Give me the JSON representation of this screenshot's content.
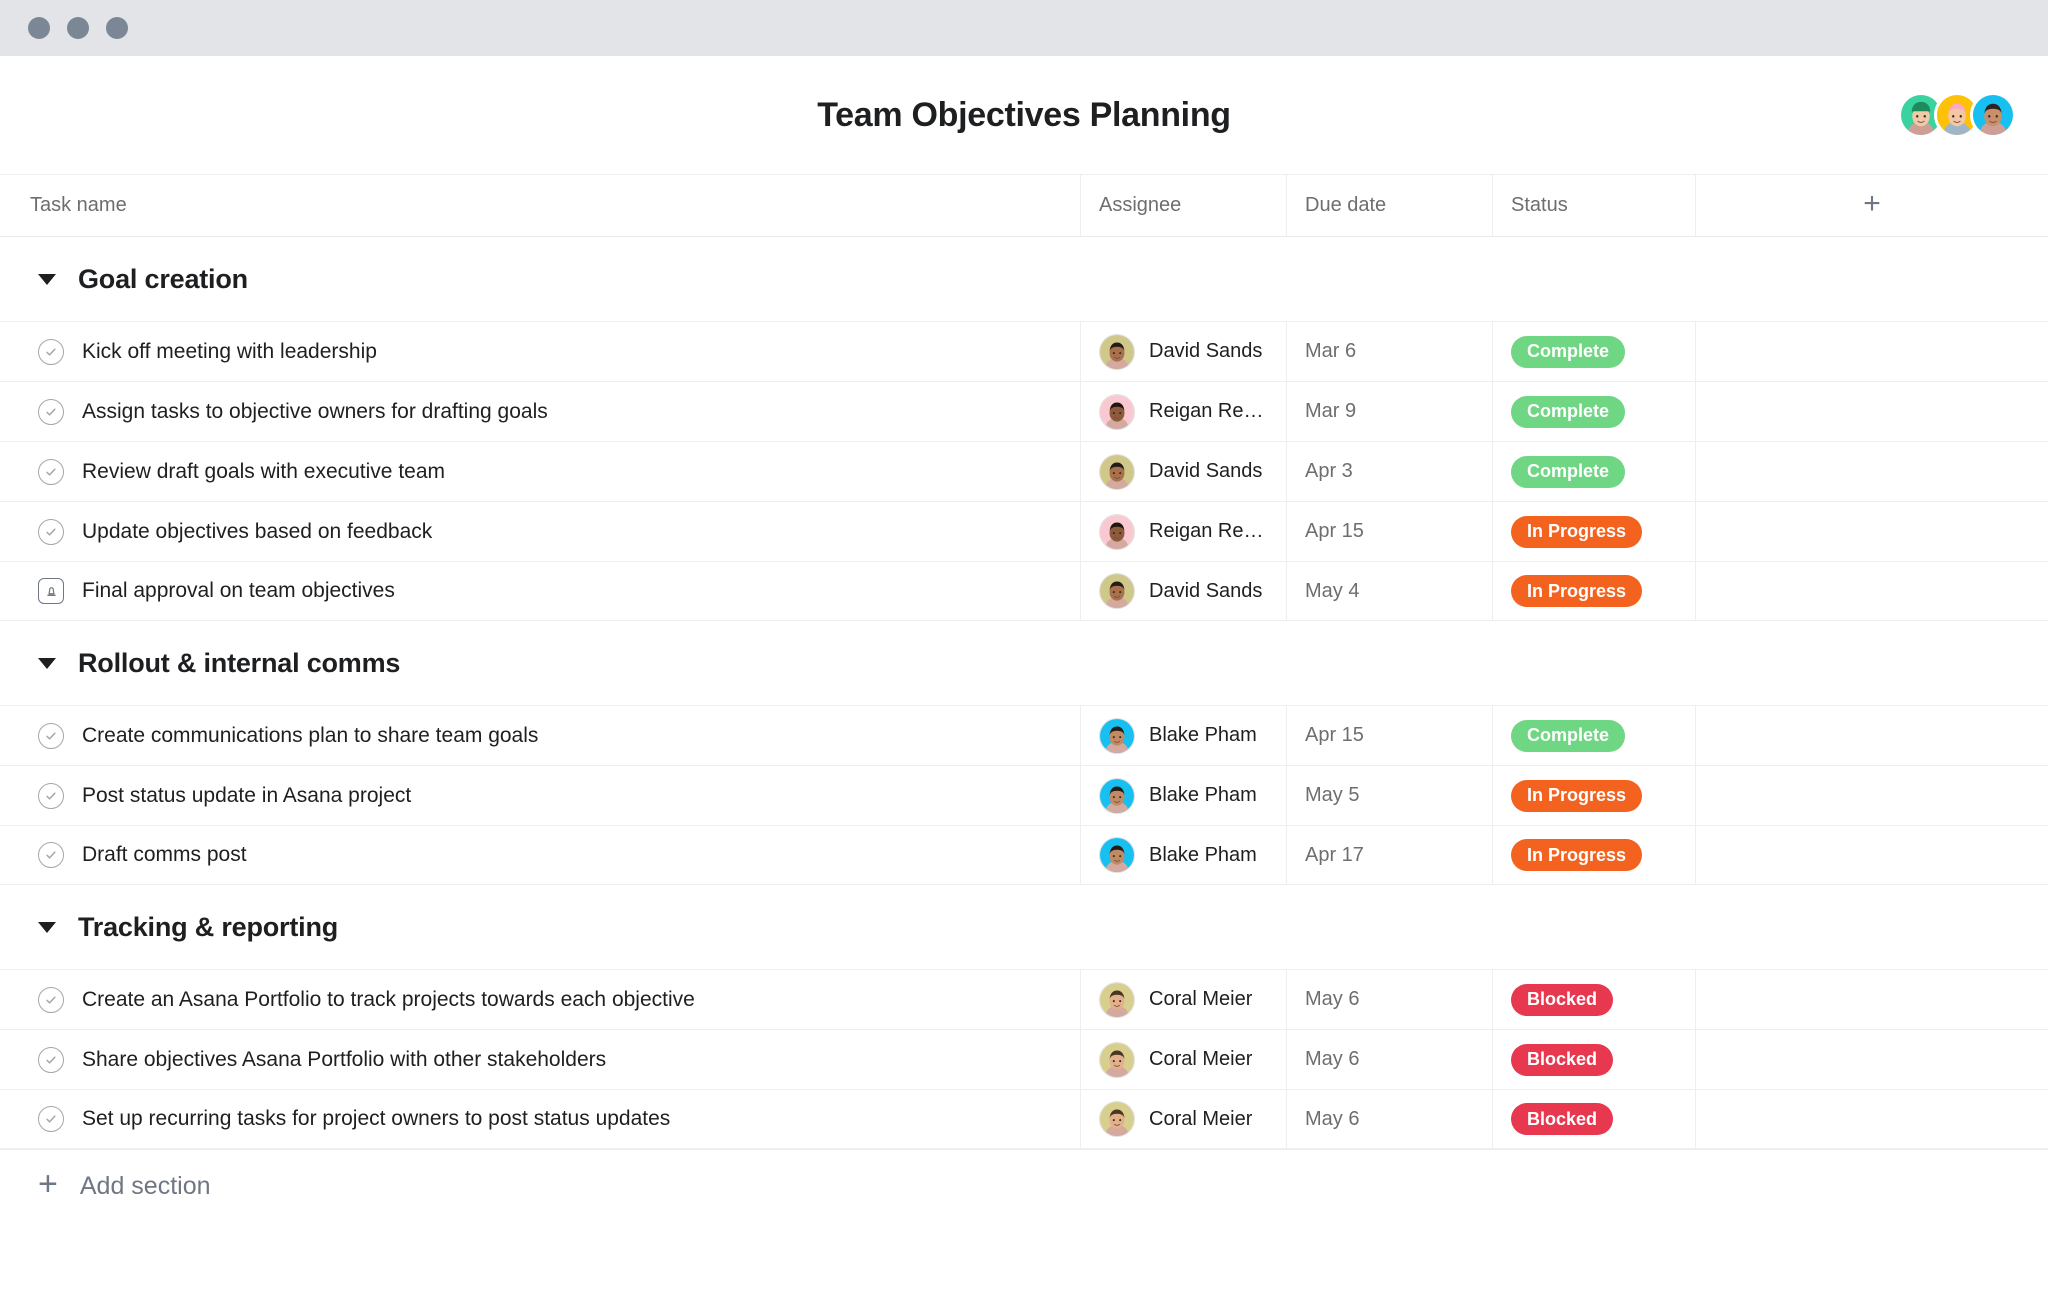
{
  "window": {
    "dots": [
      "close",
      "minimize",
      "maximize"
    ]
  },
  "header": {
    "title": "Team Objectives Planning",
    "members": [
      {
        "name": "member-1",
        "bg": "#3ad29f",
        "hair": "#1f6f4a",
        "skin": "#f0c9a8",
        "cap": "#1f8a5c"
      },
      {
        "name": "member-2",
        "bg": "#ffc107",
        "hair": "#f7a9c6",
        "skin": "#f3c7a4",
        "cap": ""
      },
      {
        "name": "member-3",
        "bg": "#17c0f0",
        "hair": "#2a2320",
        "skin": "#c98f6a",
        "cap": ""
      }
    ]
  },
  "table": {
    "columns": [
      {
        "key": "task_name",
        "label": "Task name"
      },
      {
        "key": "assignee",
        "label": "Assignee"
      },
      {
        "key": "due_date",
        "label": "Due date"
      },
      {
        "key": "status",
        "label": "Status"
      },
      {
        "key": "add_column",
        "label": "+"
      }
    ]
  },
  "status_colors": {
    "Complete": "#6fd684",
    "In Progress": "#f4621f",
    "Blocked": "#e8384f"
  },
  "people": {
    "David Sands": {
      "bg": "#cfc88a",
      "skin": "#a9714b",
      "hair": "#241c17",
      "ring": "#8f7ee0"
    },
    "Reigan Rea…": {
      "bg": "#f9c8d0",
      "skin": "#8d5a3c",
      "hair": "#201713",
      "ring": "#e8c85a"
    },
    "Blake Pham": {
      "bg": "#17c0f0",
      "skin": "#c08a64",
      "hair": "#241c17",
      "ring": "#17c0f0"
    },
    "Coral Meier": {
      "bg": "#d8cf8e",
      "skin": "#e2b08a",
      "hair": "#4a3526",
      "ring": "#cdbf6a"
    }
  },
  "sections": [
    {
      "title": "Goal creation",
      "expanded": true,
      "tasks": [
        {
          "icon": "check-circle-icon",
          "name": "Kick off meeting with leadership",
          "assignee": "David Sands",
          "due": "Mar 6",
          "status": "Complete"
        },
        {
          "icon": "check-circle-icon",
          "name": "Assign tasks to objective owners for drafting goals",
          "assignee": "Reigan Rea…",
          "due": "Mar 9",
          "status": "Complete"
        },
        {
          "icon": "check-circle-icon",
          "name": "Review draft goals with executive team",
          "assignee": "David Sands",
          "due": "Apr 3",
          "status": "Complete"
        },
        {
          "icon": "check-circle-icon",
          "name": "Update objectives based on feedback",
          "assignee": "Reigan Rea…",
          "due": "Apr 15",
          "status": "In Progress"
        },
        {
          "icon": "approval-stamp-icon",
          "name": "Final approval on team objectives",
          "assignee": "David Sands",
          "due": "May 4",
          "status": "In Progress"
        }
      ]
    },
    {
      "title": "Rollout & internal comms",
      "expanded": true,
      "tasks": [
        {
          "icon": "check-circle-icon",
          "name": "Create communications plan to share team goals",
          "assignee": "Blake Pham",
          "due": "Apr 15",
          "status": "Complete"
        },
        {
          "icon": "check-circle-icon",
          "name": "Post status update in Asana project",
          "assignee": "Blake Pham",
          "due": "May 5",
          "status": "In Progress"
        },
        {
          "icon": "check-circle-icon",
          "name": "Draft comms post",
          "assignee": "Blake Pham",
          "due": "Apr 17",
          "status": "In Progress"
        }
      ]
    },
    {
      "title": "Tracking & reporting",
      "expanded": true,
      "tasks": [
        {
          "icon": "check-circle-icon",
          "name": "Create an Asana Portfolio to track projects towards each objective",
          "assignee": "Coral Meier",
          "due": "May 6",
          "status": "Blocked"
        },
        {
          "icon": "check-circle-icon",
          "name": "Share objectives Asana Portfolio with other stakeholders",
          "assignee": "Coral Meier",
          "due": "May 6",
          "status": "Blocked"
        },
        {
          "icon": "check-circle-icon",
          "name": "Set up recurring tasks for project owners to post status updates",
          "assignee": "Coral Meier",
          "due": "May 6",
          "status": "Blocked"
        }
      ]
    }
  ],
  "footer": {
    "add_section_label": "Add section",
    "add_section_icon": "plus-icon"
  }
}
